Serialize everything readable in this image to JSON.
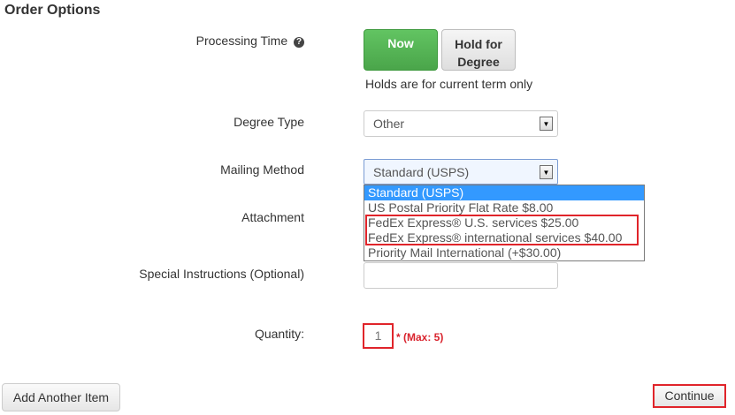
{
  "section": {
    "title": "Order Options"
  },
  "processing_time": {
    "label": "Processing Time",
    "help_icon": "question-circle-icon",
    "now_label": "Now",
    "hold_label_line1": "Hold for",
    "hold_label_line2": "Degree",
    "note": "Holds are for current term only"
  },
  "degree_type": {
    "label": "Degree Type",
    "value": "Other"
  },
  "mailing_method": {
    "label": "Mailing Method",
    "value": "Standard (USPS)",
    "options": [
      "Standard (USPS)",
      "US Postal Priority Flat Rate $8.00",
      "FedEx Express® U.S. services $25.00",
      "FedEx Express® international services $40.00",
      "Priority Mail International (+$30.00)"
    ]
  },
  "attachment": {
    "label": "Attachment"
  },
  "special_instructions": {
    "label": "Special Instructions (Optional)",
    "value": ""
  },
  "quantity": {
    "label": "Quantity:",
    "value": "1",
    "max_note": "* (Max: 5)"
  },
  "actions": {
    "add_label": "Add Another Item",
    "continue_label": "Continue"
  },
  "colors": {
    "accent_green": "#5cb85c",
    "highlight_red": "#e0242a",
    "dropdown_selected": "#3399ff"
  }
}
